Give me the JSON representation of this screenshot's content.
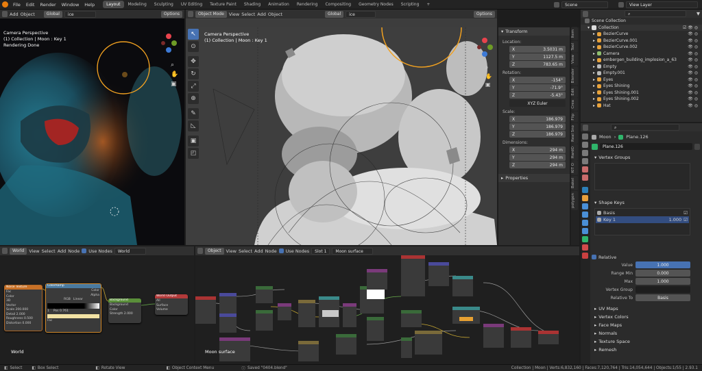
{
  "menu": [
    "File",
    "Edit",
    "Render",
    "Window",
    "Help"
  ],
  "workspaces": [
    "Layout",
    "Modeling",
    "Sculpting",
    "UV Editing",
    "Texture Paint",
    "Shading",
    "Animation",
    "Rendering",
    "Compositing",
    "Geometry Nodes",
    "Scripting"
  ],
  "active_workspace": "Layout",
  "scene": "Scene",
  "view_layer": "View Layer",
  "render_view": {
    "overlay_title": "Camera Perspective",
    "overlay_sub": "(1) Collection | Moon : Key 1",
    "overlay_status": "Rendering Done",
    "header": [
      "Add",
      "Object"
    ],
    "orientation": "Global",
    "search": "ice",
    "options": "Options"
  },
  "viewport": {
    "mode": "Object Mode",
    "menus": [
      "View",
      "Select",
      "Add",
      "Object"
    ],
    "orientation": "Global",
    "search": "ice",
    "options": "Options",
    "overlay_title": "Camera Perspective",
    "overlay_sub": "(1) Collection | Moon : Key 1"
  },
  "transform": {
    "title": "Transform",
    "location_label": "Location:",
    "location": [
      {
        "axis": "X",
        "value": "3.5031 m"
      },
      {
        "axis": "Y",
        "value": "1127.5 m"
      },
      {
        "axis": "Z",
        "value": "783.65 m"
      }
    ],
    "rotation_label": "Rotation:",
    "rotation": [
      {
        "axis": "X",
        "value": "-154°"
      },
      {
        "axis": "Y",
        "value": "-71.9°"
      },
      {
        "axis": "Z",
        "value": "-5.43°"
      }
    ],
    "rotation_mode": "XYZ Euler",
    "scale_label": "Scale:",
    "scale": [
      {
        "axis": "X",
        "value": "186.979"
      },
      {
        "axis": "Y",
        "value": "186.979"
      },
      {
        "axis": "Z",
        "value": "186.979"
      }
    ],
    "dimensions_label": "Dimensions:",
    "dimensions": [
      {
        "axis": "X",
        "value": "294 m"
      },
      {
        "axis": "Y",
        "value": "294 m"
      },
      {
        "axis": "Z",
        "value": "294 m"
      }
    ],
    "properties": "Properties"
  },
  "sidebar_tabs": [
    "Item",
    "Tool",
    "View",
    "Blender",
    "Edit",
    "Crea",
    "Flip",
    "Real Sno",
    "HardO",
    "KIT O",
    "Bakel",
    "polygon"
  ],
  "outliner": {
    "root": "Scene Collection",
    "collection": "Collection",
    "items": [
      {
        "name": "BezierCurve",
        "color": "#e8a33c"
      },
      {
        "name": "BezierCurve.001",
        "color": "#e8a33c"
      },
      {
        "name": "BezierCurve.002",
        "color": "#e8a33c"
      },
      {
        "name": "Camera",
        "color": "#8fbf6f"
      },
      {
        "name": "embergen_building_implosion_a_63",
        "color": "#e8a33c"
      },
      {
        "name": "Empty",
        "color": "#bbbbbb"
      },
      {
        "name": "Empty.001",
        "color": "#bbbbbb"
      },
      {
        "name": "Eyes",
        "color": "#e8a33c"
      },
      {
        "name": "Eyes Shining",
        "color": "#e8a33c"
      },
      {
        "name": "Eyes Shining.001",
        "color": "#e8a33c"
      },
      {
        "name": "Eyes Shining.002",
        "color": "#e8a33c"
      },
      {
        "name": "Hat",
        "color": "#e8a33c"
      }
    ]
  },
  "props": {
    "object_name": "Moon",
    "data_name": "Plane.126",
    "mesh_name": "Plane.126",
    "vertex_groups": "Vertex Groups",
    "shape_keys": "Shape Keys",
    "keys": [
      {
        "name": "Basis",
        "value": ""
      },
      {
        "name": "Key 1",
        "value": "1.000"
      }
    ],
    "relative": "Relative",
    "value_label": "Value",
    "value": "1.000",
    "range_min_label": "Range Min",
    "range_min": "0.000",
    "max_label": "Max",
    "max": "1.000",
    "vertex_group_label": "Vertex Group",
    "relative_to_label": "Relative To",
    "relative_to": "Basis",
    "collapsed": [
      "UV Maps",
      "Vertex Colors",
      "Face Maps",
      "Normals",
      "Texture Space",
      "Remesh"
    ]
  },
  "world_editor": {
    "type": "World",
    "menus": [
      "View",
      "Select",
      "Add",
      "Node"
    ],
    "use_nodes": "Use Nodes",
    "world_name": "World",
    "footer_label": "World"
  },
  "shader_editor": {
    "type": "Object",
    "menus": [
      "View",
      "Select",
      "Add",
      "Node"
    ],
    "use_nodes": "Use Nodes",
    "slot": "Slot 1",
    "material": "Moon surface",
    "footer_label": "Moon surface"
  },
  "world_nodes": {
    "tex": {
      "title": "Noise Texture",
      "rows": [
        "Fac",
        "Color",
        "3D",
        "Vector",
        "Scale 200.000",
        "Detail 2.000",
        "Roughness 0.500",
        "Distortion 0.000"
      ]
    },
    "ramp": {
      "title": "ColorRamp",
      "rows": [
        "Color",
        "Alpha",
        "RGB",
        "Linear",
        "1",
        "Pos 0.761",
        "Fac"
      ]
    },
    "bg": {
      "title": "Background",
      "rows": [
        "Background",
        "Color",
        "Strength 2.000"
      ]
    },
    "out": {
      "title": "World Output",
      "rows": [
        "All",
        "Surface",
        "Volume"
      ]
    }
  },
  "status": {
    "select": "Select",
    "box_select": "Box Select",
    "rotate": "Rotate View",
    "context": "Object Context Menu",
    "saved": "Saved \"0404.blend\"",
    "stats": "Collection | Moon | Verts:6,832,160 | Faces:7,120,764 | Tris:14,054,644 | Objects:1/55 | 2.93.1"
  }
}
